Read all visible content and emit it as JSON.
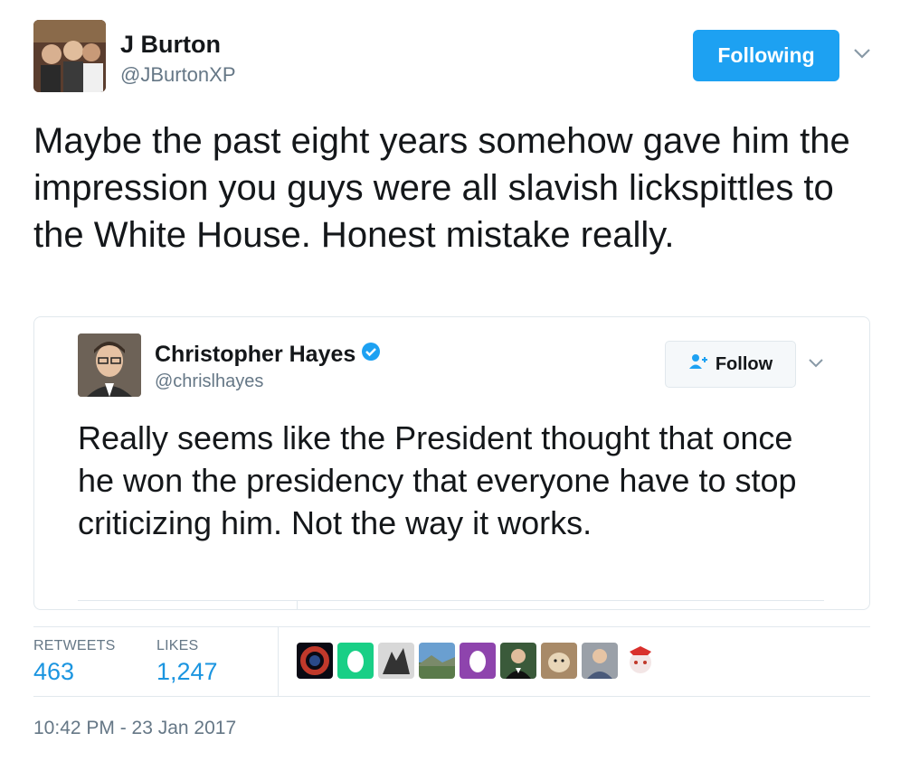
{
  "tweet": {
    "author_name": "J Burton",
    "author_handle": "@JBurtonXP",
    "following_label": "Following",
    "text": "Maybe the past eight years somehow gave him the impression you guys were all slavish lickspittles to the White House. Honest mistake really.",
    "timestamp": "10:42 PM - 23 Jan 2017"
  },
  "quoted": {
    "author_name": "Christopher Hayes",
    "author_handle": "@chrislhayes",
    "verified": true,
    "follow_label": "Follow",
    "text": "Really seems like the President thought that once he won the presidency that everyone have to stop criticizing him. Not the way it works."
  },
  "stats": {
    "retweets_label": "RETWEETS",
    "retweets": "463",
    "likes_label": "LIKES",
    "likes": "1,247"
  },
  "liker_avatars": [
    "nebula-avatar",
    "egg-green-avatar",
    "dragon-avatar",
    "landscape-avatar",
    "egg-purple-avatar",
    "tux-man-avatar",
    "dog-avatar",
    "man-avatar",
    "anime-girl-avatar"
  ],
  "colors": {
    "accent": "#1da1f2",
    "link": "#1b95e0",
    "secondary_text": "#657786",
    "border": "#e1e8ed"
  }
}
